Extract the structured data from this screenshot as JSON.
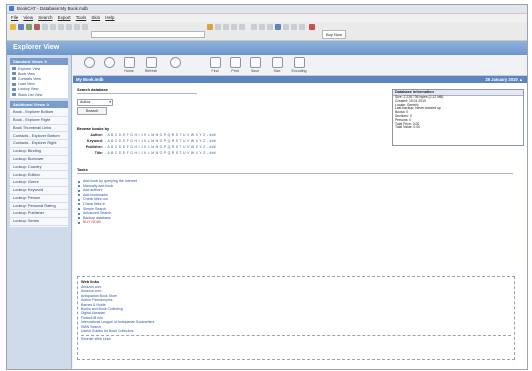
{
  "window": {
    "title": "BookCAT - Database:My Book.mdb"
  },
  "menu": [
    "File",
    "View",
    "Search",
    "Export",
    "Tools",
    "Skin",
    "Help"
  ],
  "toolbar": {
    "buy_now": "Buy Now"
  },
  "explorer": {
    "title": "Explorer View"
  },
  "sidebar": {
    "standard_header": "Standard Views ☆",
    "standard_items": [
      "Explorer View",
      "Book View",
      "Contacts View",
      "Loan View",
      "Lookup View",
      "Stack List View"
    ],
    "additional_header": "Additional Views ☆",
    "additional_items": [
      "Book - Explorer Bottom",
      "Book - Explorer Right",
      "Book Thumbnail Links",
      "Contacts - Explorer Bottom",
      "Contacts - Explorer Right",
      "Lookup: Binding",
      "Lookup: Borrower",
      "Lookup: Country",
      "Lookup: Edition",
      "Lookup: Genre",
      "Lookup: Keyword",
      "Lookup: Person",
      "Lookup: Personal Rating",
      "Lookup: Publisher",
      "Lookup: Series"
    ]
  },
  "nav": {
    "home": "Home",
    "refresh": "Refresh",
    "find": "Find",
    "print": "Print",
    "save": "Save",
    "size": "Size",
    "encoding": "Encoding"
  },
  "page": {
    "header_left": "My Book.mdb",
    "header_date": "28 January 2010 ▲"
  },
  "search": {
    "title": "Search database",
    "select_value": "Author",
    "button": "Search"
  },
  "browse": {
    "title": "Browse books by",
    "rows": [
      {
        "label": "Author:",
        "letters": "- A B C D E F G H I J K L M N O P Q R S T U V W X Y Z - ###"
      },
      {
        "label": "Keyword:",
        "letters": "- A B C D E F G H I J K L M N O P Q R S T U V W X Y Z - ###"
      },
      {
        "label": "Publisher:",
        "letters": "- A B C D E F G H I J K L M N O P Q R S T U V W X Y Z - ###"
      },
      {
        "label": "Title:",
        "letters": "- A B C D E F G H I J K L M N O P Q R S T U V W X Y Z - ###"
      }
    ]
  },
  "tasks": {
    "title": "Tasks",
    "items": [
      "Add book by querying the Internet",
      "Manually add book",
      "Add authors",
      "Add bookmarks",
      "Check titles out",
      "Check titles in",
      "Simple Search",
      "Advanced Search",
      "Backup database",
      "BUY NOW!"
    ]
  },
  "weblinks": {
    "title": "Web links",
    "items": [
      "Amazon.com",
      "Amazon.com",
      "Antiquarian Book Store",
      "Author Pseudonyms",
      "Barnes & Noble",
      "Books and Book Collecting",
      "Digital Librarian",
      "FictionDB.info",
      "International League of Antiquarian Booksellers",
      "ISBN Search",
      "Useful Guides for Book Collectors"
    ],
    "footer": "Reorder Web Links"
  },
  "dbinfo": {
    "title": "Database information",
    "rows": [
      "Size: 2 228 736 bytes (2,12 MB)",
      "Created: 15.01.2010",
      "Locale: Generic",
      "Last backup: Never backed up",
      "Books: 0",
      "Sections: 0",
      "Persons: 0",
      "Total Price: 0.00",
      "Total Value: 0.00"
    ]
  },
  "colors": {
    "accent": "#5b84c0",
    "header_blue": "#6f97cd",
    "link": "#2c57a0",
    "buy_now": "#c0392b"
  }
}
